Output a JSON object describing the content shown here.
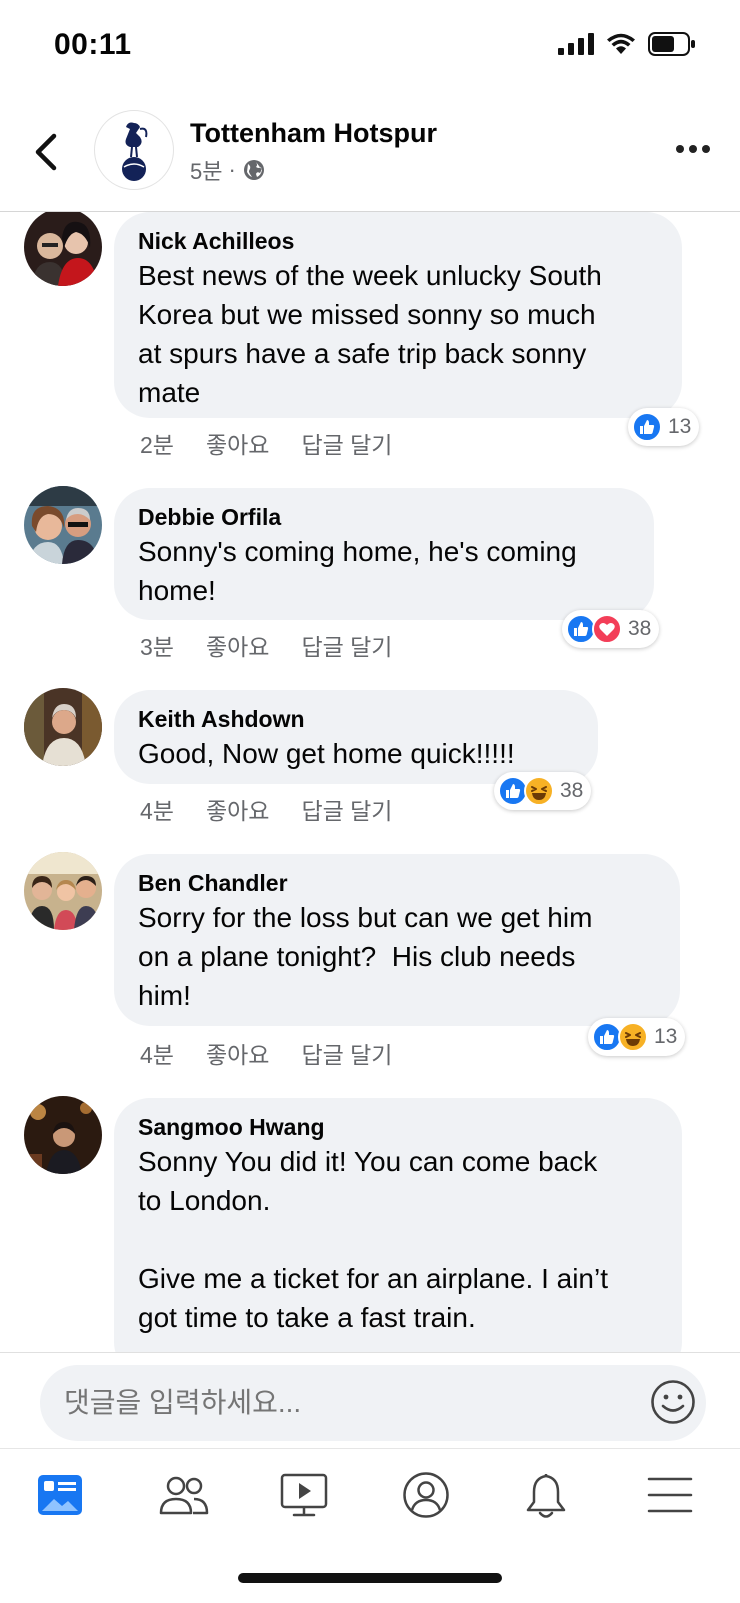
{
  "status_bar": {
    "time": "00:11",
    "battery_level": 0.65
  },
  "header": {
    "page_name": "Tottenham Hotspur",
    "time_ago": "5분",
    "separator": "·",
    "audience_icon": "globe-icon"
  },
  "comments": [
    {
      "author": "Nick Achilleos",
      "text": "Best news of the week unlucky South\nKorea but we missed sonny so much\nat spurs have a safe trip back sonny\nmate",
      "time": "2분",
      "like_label": "좋아요",
      "reply_label": "답글 달기",
      "reactions": [
        "like"
      ],
      "reaction_count": "13"
    },
    {
      "author": "Debbie Orfila",
      "text": "Sonny's coming home, he's coming\nhome!",
      "time": "3분",
      "like_label": "좋아요",
      "reply_label": "답글 달기",
      "reactions": [
        "like",
        "love"
      ],
      "reaction_count": "38"
    },
    {
      "author": "Keith Ashdown",
      "text": "Good, Now get home quick!!!!!",
      "time": "4분",
      "like_label": "좋아요",
      "reply_label": "답글 달기",
      "reactions": [
        "like",
        "haha"
      ],
      "reaction_count": "38"
    },
    {
      "author": "Ben Chandler",
      "text": "Sorry for the loss but can we get him\non a plane tonight?  His club needs\nhim!",
      "time": "4분",
      "like_label": "좋아요",
      "reply_label": "답글 달기",
      "reactions": [
        "like",
        "haha"
      ],
      "reaction_count": "13"
    },
    {
      "author": "Sangmoo Hwang",
      "text": "Sonny You did it! You can come back\nto London.\n\nGive me a ticket for an airplane. I ain’t\ngot time to take a fast train.",
      "time": "",
      "like_label": "",
      "reply_label": "",
      "reactions": [],
      "reaction_count": ""
    }
  ],
  "composer": {
    "placeholder": "댓글을 입력하세요...",
    "emoji_icon": "smiley-icon"
  },
  "tab_bar": [
    {
      "name": "news-feed",
      "icon": "news-feed-icon",
      "active": true
    },
    {
      "name": "friends",
      "icon": "friends-icon",
      "active": false
    },
    {
      "name": "watch",
      "icon": "watch-icon",
      "active": false
    },
    {
      "name": "profile",
      "icon": "profile-icon",
      "active": false
    },
    {
      "name": "notifications",
      "icon": "bell-icon",
      "active": false
    },
    {
      "name": "menu",
      "icon": "menu-icon",
      "active": false
    }
  ],
  "colors": {
    "like_blue": "#1877f2",
    "love_red": "#f33e58",
    "haha_yellow": "#f7b125",
    "bubble_gray": "#f0f2f5",
    "secondary_text": "#65676b"
  }
}
